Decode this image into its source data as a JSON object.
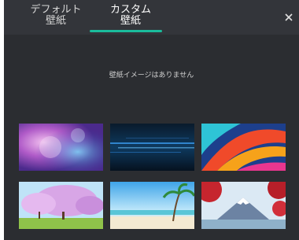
{
  "tabs": {
    "default_label_line1": "デフォルト",
    "default_label_line2": "壁紙",
    "custom_label_line1": "カスタム",
    "custom_label_line2": "壁紙",
    "active": "custom"
  },
  "message": "壁紙イメージはありません",
  "colors": {
    "panel_bg": "#2b2d31",
    "tabbar_bg": "#33353a",
    "accent": "#1abc9c"
  },
  "icons": {
    "close": "close-icon"
  },
  "wallpapers": [
    {
      "subject": "purple-nebula"
    },
    {
      "subject": "dark-blue-light-streaks"
    },
    {
      "subject": "colorful-swirl"
    },
    {
      "subject": "cherry-blossom-trees"
    },
    {
      "subject": "tropical-beach-palm"
    },
    {
      "subject": "mount-fuji-red-leaves"
    }
  ]
}
